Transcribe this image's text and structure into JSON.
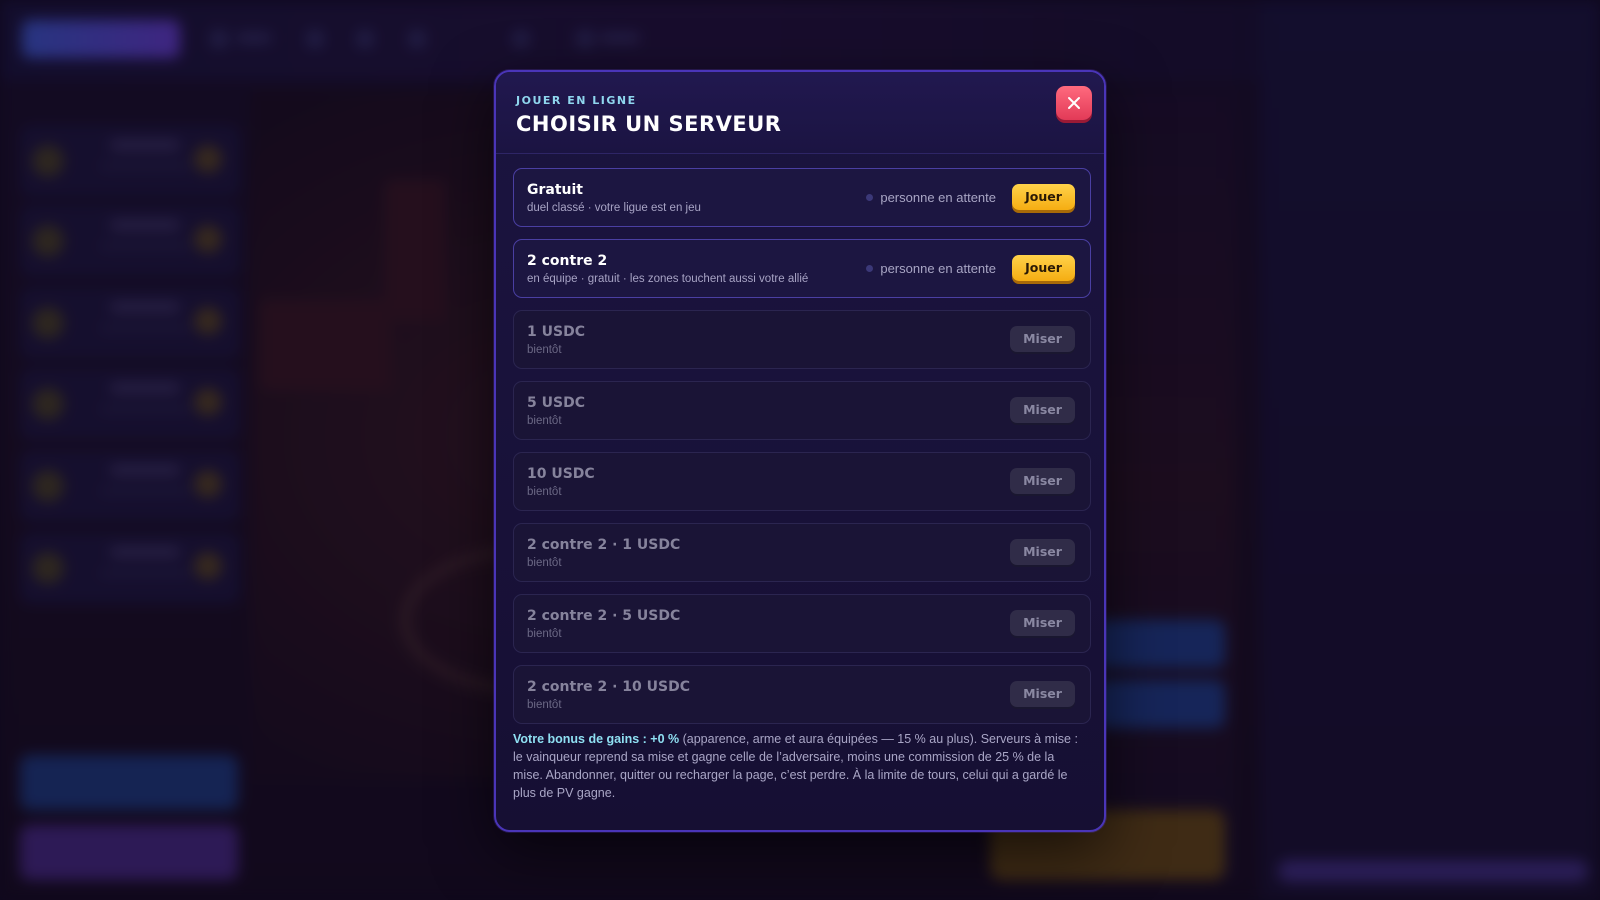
{
  "modal": {
    "eyebrow": "JOUER EN LIGNE",
    "title": "CHOISIR UN SERVEUR",
    "close_icon": "close-icon"
  },
  "servers": [
    {
      "name": "Gratuit",
      "subtitle": "duel classé · votre ligue est en jeu",
      "status": "personne en attente",
      "action": "Jouer",
      "available": true
    },
    {
      "name": "2 contre 2",
      "subtitle": "en équipe · gratuit · les zones touchent aussi votre allié",
      "status": "personne en attente",
      "action": "Jouer",
      "available": true
    },
    {
      "name": "1 USDC",
      "subtitle": "bientôt",
      "action": "Miser",
      "available": false
    },
    {
      "name": "5 USDC",
      "subtitle": "bientôt",
      "action": "Miser",
      "available": false
    },
    {
      "name": "10 USDC",
      "subtitle": "bientôt",
      "action": "Miser",
      "available": false
    },
    {
      "name": "2 contre 2 · 1 USDC",
      "subtitle": "bientôt",
      "action": "Miser",
      "available": false
    },
    {
      "name": "2 contre 2 · 5 USDC",
      "subtitle": "bientôt",
      "action": "Miser",
      "available": false
    },
    {
      "name": "2 contre 2 · 10 USDC",
      "subtitle": "bientôt",
      "action": "Miser",
      "available": false
    }
  ],
  "note": {
    "bonus": "Votre bonus de gains : +0 %",
    "text": " (apparence, arme et aura équipées — 15 % au plus). Serveurs à mise : le vainqueur reprend sa mise et gagne celle de l’adversaire, moins une commission de 25 % de la mise. Abandonner, quitter ou recharger la page, c’est perdre. À la limite de tours, celui qui a gardé le plus de PV gagne."
  },
  "colors": {
    "accent": "#8fd6ee",
    "play": "#f5ad12",
    "close": "#e23a57",
    "modal_border": "#4a35b8"
  }
}
